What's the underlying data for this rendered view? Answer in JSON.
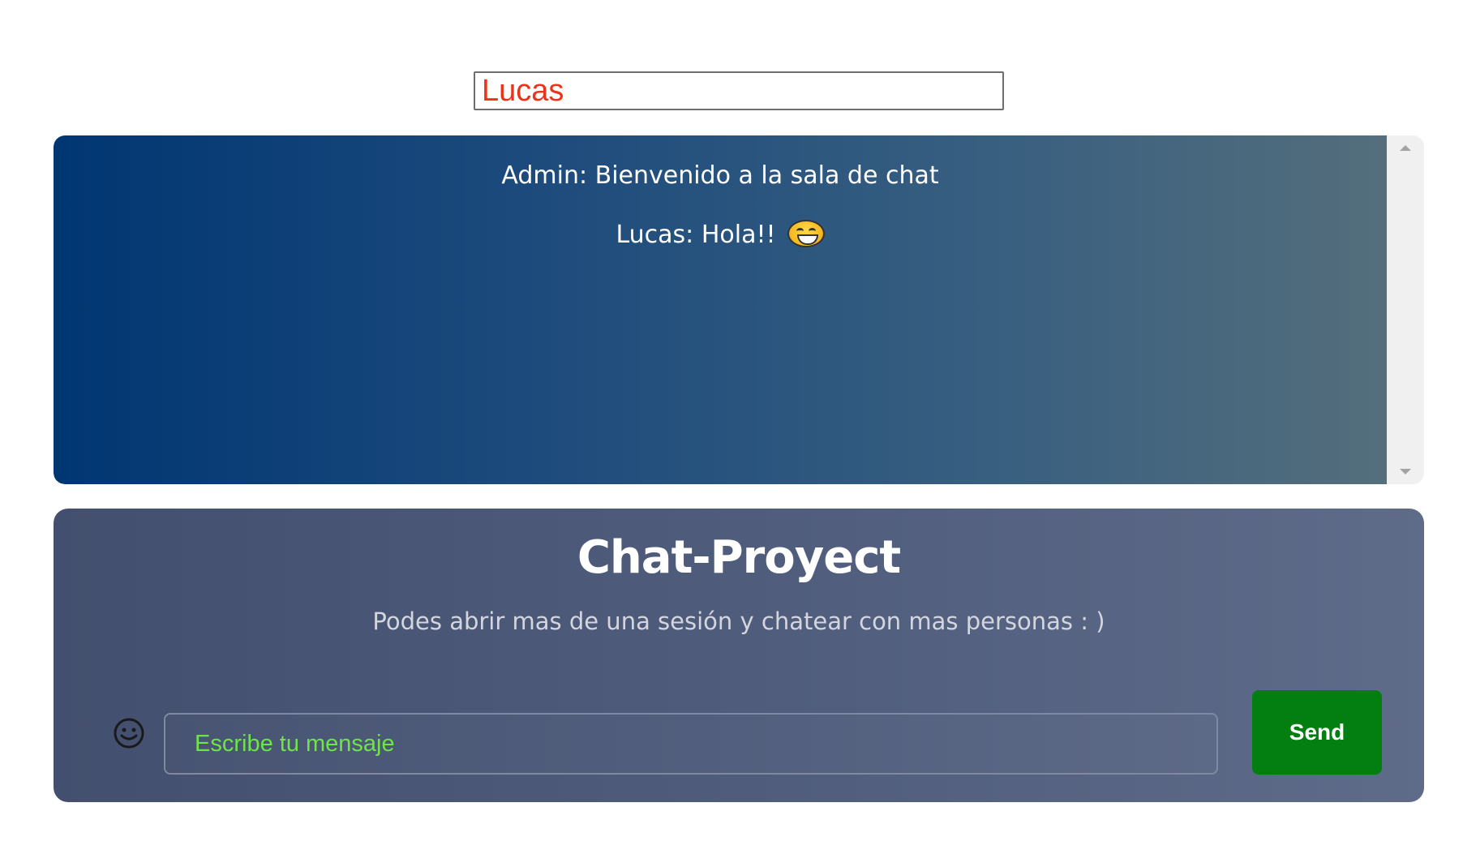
{
  "username": {
    "value": "Lucas"
  },
  "messages": [
    {
      "text": "Admin: Bienvenido a la sala de chat"
    },
    {
      "text": "Lucas: Hola!!",
      "emoji": "grinning-face-icon"
    }
  ],
  "chat": {
    "title": "Chat-Proyect",
    "subtitle": "Podes abrir mas de una sesión y chatear con mas personas : )",
    "input_placeholder": "Escribe tu mensaje",
    "input_value": "",
    "send_label": "Send"
  },
  "colors": {
    "username_text": "#e8341c",
    "placeholder_text": "#6fe34a",
    "send_button": "#037f12",
    "messages_gradient_start": "#003672",
    "messages_gradient_end": "#546e7c",
    "card_gradient_start": "#434f6e",
    "card_gradient_end": "#5e6b89"
  },
  "icons": {
    "emoji_picker": "smiley-icon",
    "message_emoji": "grinning-face-icon"
  }
}
